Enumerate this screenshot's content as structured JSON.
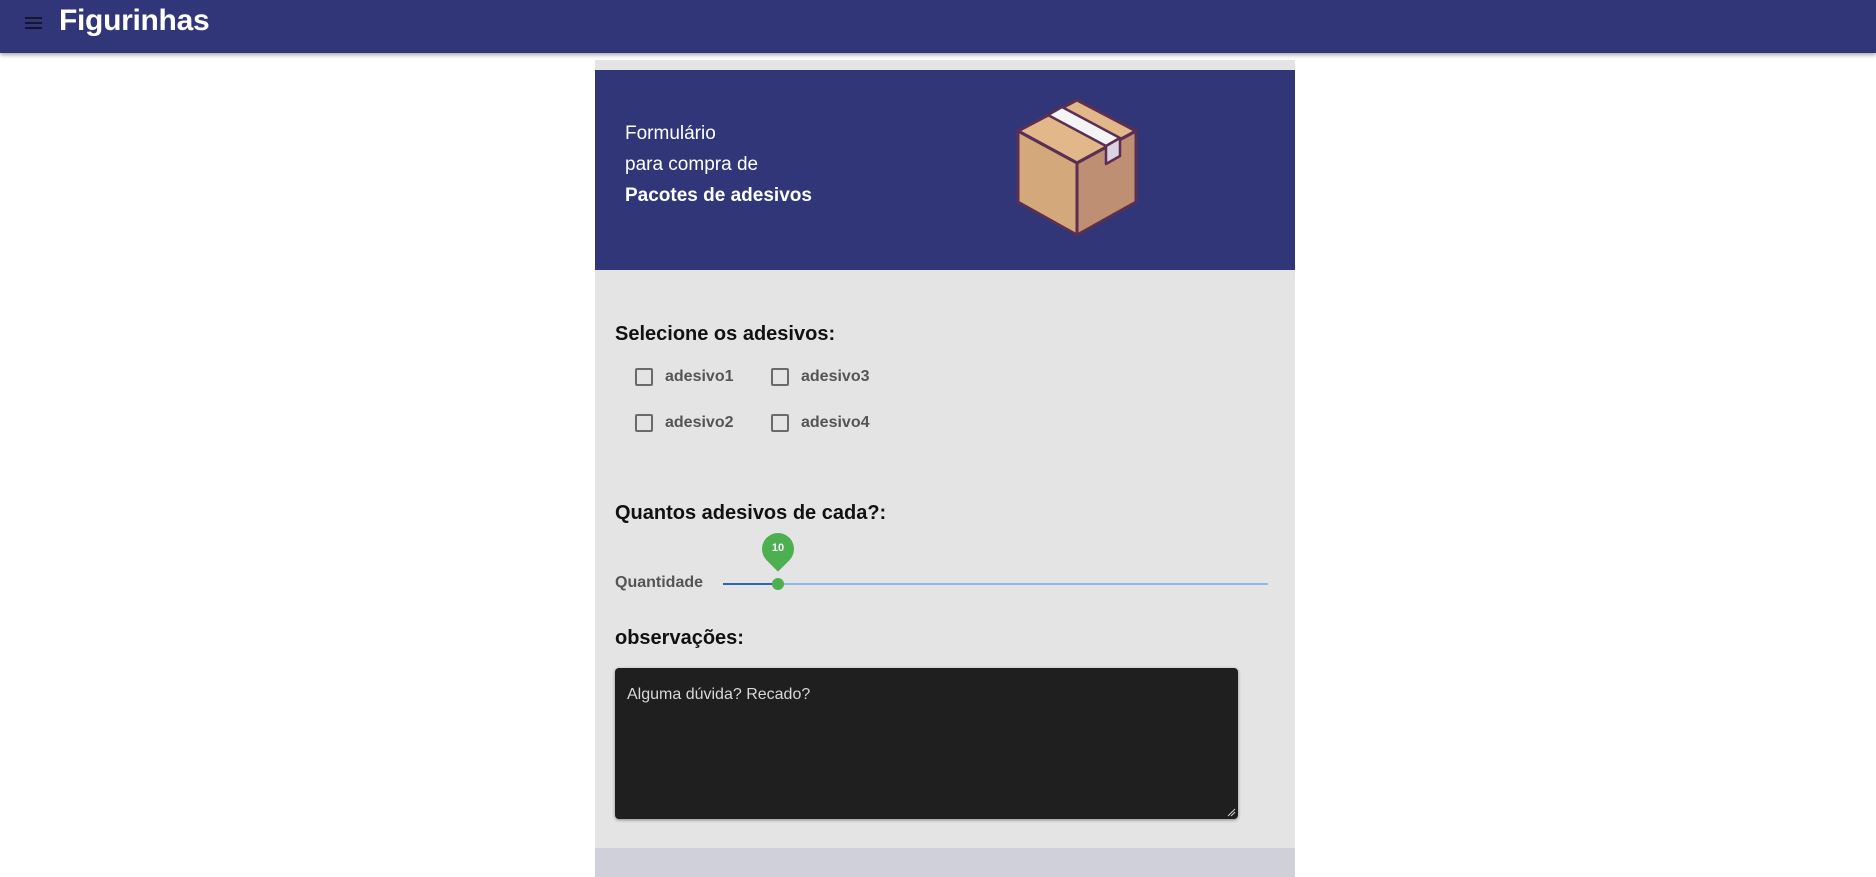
{
  "app": {
    "title": "Figurinhas"
  },
  "hero": {
    "line1": "Formulário",
    "line2": "para compra de",
    "line3": "Pacotes de adesivos",
    "icon": "package-box-icon"
  },
  "stickers": {
    "heading": "Selecione os adesivos:",
    "options": [
      {
        "label": "adesivo1",
        "checked": false
      },
      {
        "label": "adesivo2",
        "checked": false
      },
      {
        "label": "adesivo3",
        "checked": false
      },
      {
        "label": "adesivo4",
        "checked": false
      }
    ]
  },
  "quantity": {
    "heading": "Quantos adesivos de cada?:",
    "label": "Quantidade",
    "value": "10",
    "fraction": 0.1
  },
  "notes": {
    "heading": "observações:",
    "placeholder": "Alguma dúvida? Recado?"
  },
  "colors": {
    "brand": "#303677",
    "accent": "#4caf50",
    "card": "#e4e4e4",
    "textarea": "#1f1f1f"
  }
}
